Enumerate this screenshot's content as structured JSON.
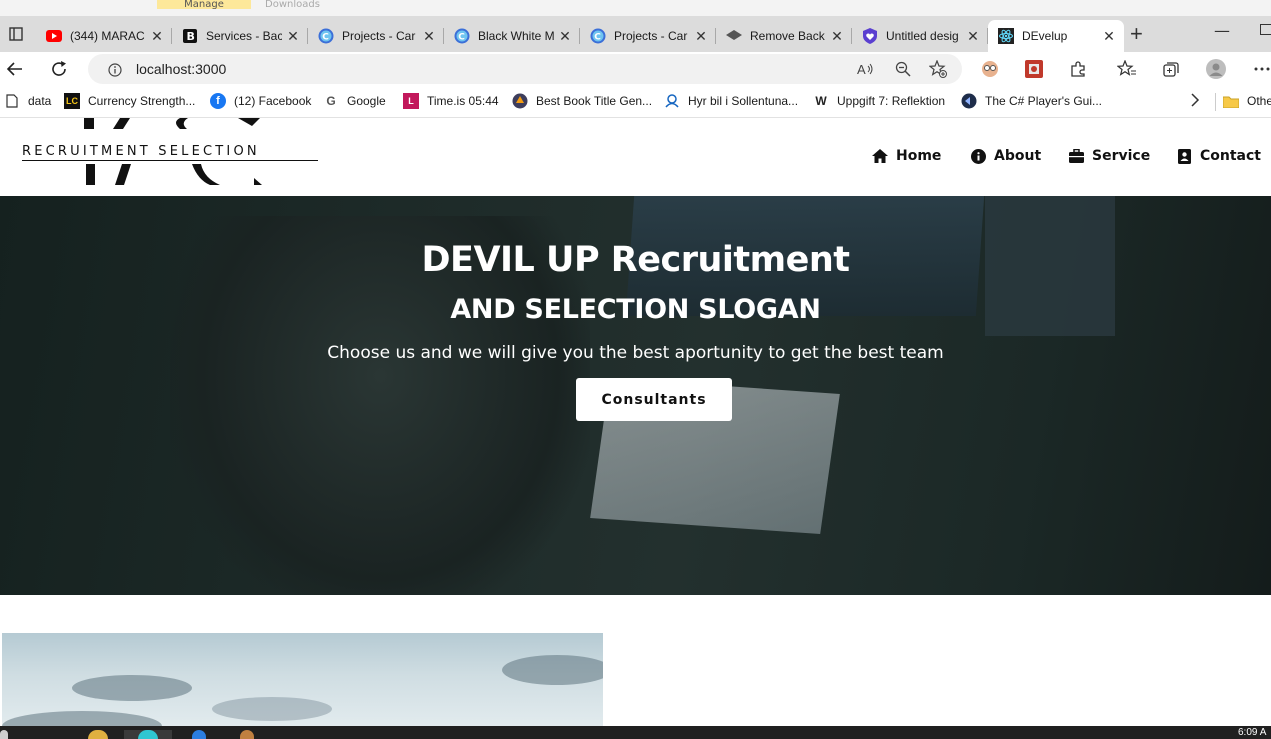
{
  "top_strip": {
    "manage_label": "Manage",
    "downloads_label": "Downloads"
  },
  "tabs": [
    {
      "title": "(344) MARAC",
      "icon": "youtube-icon",
      "active": false
    },
    {
      "title": "Services - Bac",
      "icon": "bootstrap-icon",
      "active": false
    },
    {
      "title": "Projects - Car",
      "icon": "canva-icon",
      "active": false
    },
    {
      "title": "Black White M",
      "icon": "canva-icon",
      "active": false
    },
    {
      "title": "Projects - Car",
      "icon": "canva-icon",
      "active": false
    },
    {
      "title": "Remove Back",
      "icon": "remove-bg-icon",
      "active": false
    },
    {
      "title": "Untitled desig",
      "icon": "shield-heart-icon",
      "active": false
    },
    {
      "title": "DEvelup",
      "icon": "react-icon",
      "active": true
    }
  ],
  "address_bar": {
    "url": "localhost:3000"
  },
  "bookmarks": [
    {
      "label": "data",
      "icon": "document-icon"
    },
    {
      "label": "Currency Strength...",
      "icon": "lc-icon",
      "icon_text": "LC"
    },
    {
      "label": "(12) Facebook",
      "icon": "facebook-icon",
      "icon_text": "f"
    },
    {
      "label": "Google",
      "icon": "google-icon",
      "icon_text": "G"
    },
    {
      "label": "Time.is 05:44",
      "icon": "timeis-icon",
      "icon_text": "L"
    },
    {
      "label": "Best Book Title Gen...",
      "icon": "book-icon"
    },
    {
      "label": "Hyr bil i Sollentuna...",
      "icon": "car-rental-icon"
    },
    {
      "label": "Uppgift 7: Reflektion",
      "icon": "w-icon",
      "icon_text": "W"
    },
    {
      "label": "The C# Player's Gui...",
      "icon": "csharp-icon"
    }
  ],
  "bookmarks_other": "Othe",
  "site": {
    "logo_text": "RECRUITMENT SELECTION",
    "nav": [
      {
        "label": "Home",
        "icon": "home-icon"
      },
      {
        "label": "About",
        "icon": "info-icon"
      },
      {
        "label": "Service",
        "icon": "briefcase-icon"
      },
      {
        "label": "Contact",
        "icon": "contact-card-icon"
      }
    ],
    "hero": {
      "title": "DEVIL UP Recruitment",
      "subtitle": "AND SELECTION SLOGAN",
      "text": "Choose us and we will give you the best aportunity to get the best team",
      "button": "Consultants"
    }
  },
  "taskbar": {
    "clock": "6:09 A"
  },
  "colors": {
    "tab_strip": "#dcdcdc",
    "hero_overlay": "#1d2a28",
    "youtube": "#ff0000",
    "facebook": "#1877f2"
  }
}
